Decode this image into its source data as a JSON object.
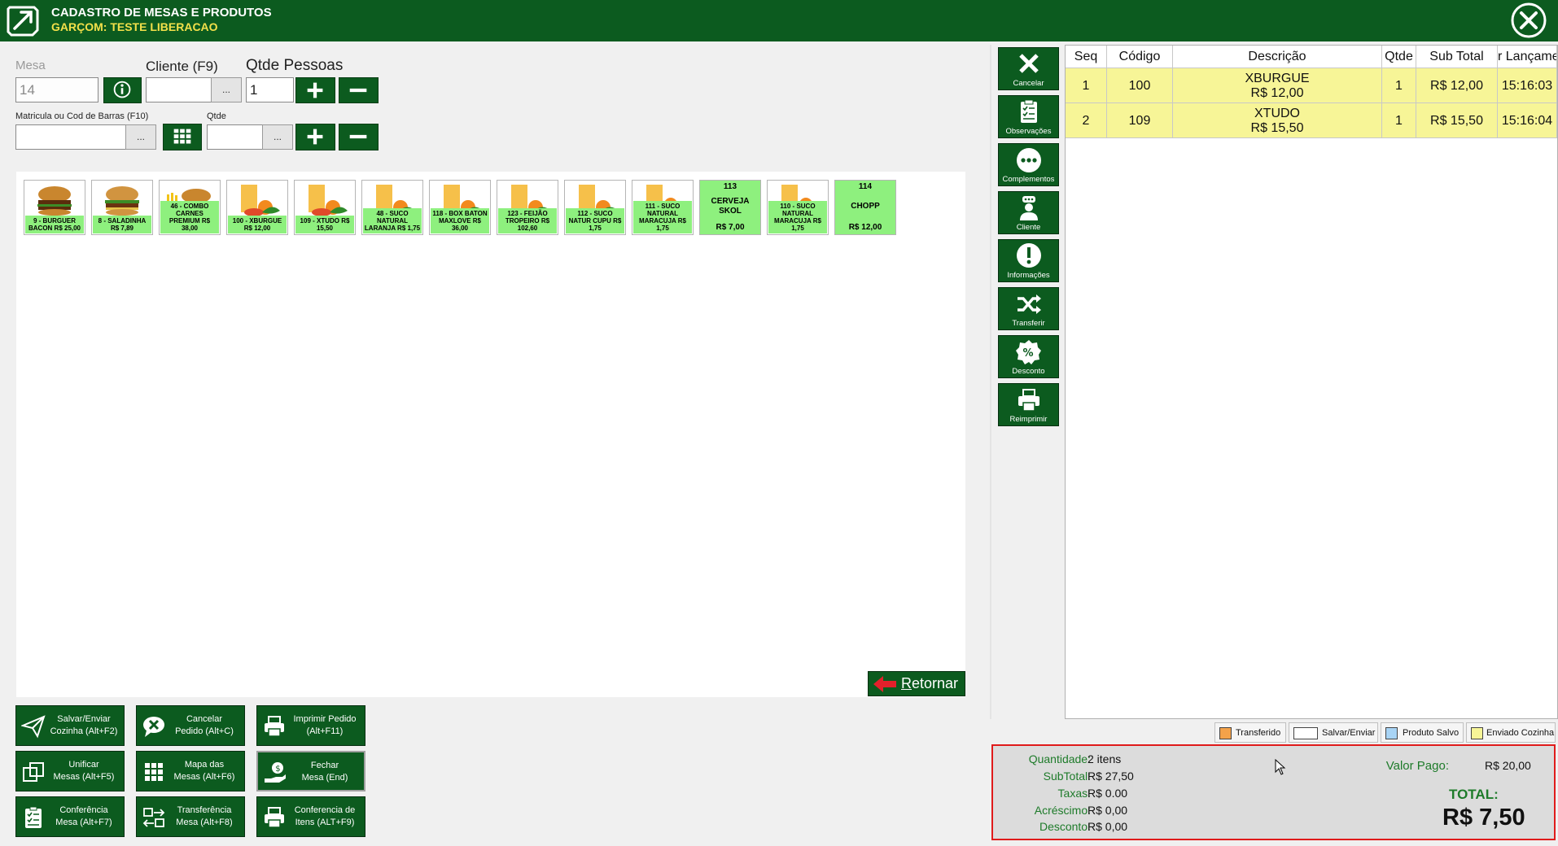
{
  "header": {
    "title": "CADASTRO DE MESAS E PRODUTOS",
    "subtitle": "GARÇOM: TESTE LIBERACAO"
  },
  "form": {
    "mesa_label": "Mesa",
    "mesa_value": "14",
    "cliente_label": "Cliente (F9)",
    "cliente_value": "",
    "qtde_pessoas_label": "Qtde Pessoas",
    "qtde_pessoas_value": "1",
    "matricula_label": "Matricula ou Cod de Barras (F10)",
    "matricula_value": "",
    "qtde_label": "Qtde",
    "qtde_value": "",
    "ellipsis": "..."
  },
  "products": [
    {
      "caption": "9 - BURGUER BACON R$ 25,00",
      "icon": "burger-image"
    },
    {
      "caption": "8 - SALADINHA R$ 7,89",
      "icon": "burger-image"
    },
    {
      "caption": "46 - COMBO CARNES PREMIUM R$ 38,00",
      "icon": "combo-image"
    },
    {
      "caption": "100 - XBURGUE R$ 12,00",
      "icon": "juice-image"
    },
    {
      "caption": "109 - XTUDO R$ 15,50",
      "icon": "juice-image"
    },
    {
      "caption": "48 - SUCO NATURAL LARANJA R$ 1,75",
      "icon": "juice-image"
    },
    {
      "caption": "118 - BOX BATON MAXLOVE R$ 36,00",
      "icon": "juice-image"
    },
    {
      "caption": "123 - FEIJÃO TROPEIRO R$ 102,60",
      "icon": "juice-image"
    },
    {
      "caption": "112 - SUCO NATUR CUPU R$ 1,75",
      "icon": "juice-image"
    },
    {
      "caption": "111 - SUCO NATURAL MARACUJA R$ 1,75",
      "icon": "juice-image"
    },
    {
      "code": "113",
      "name": "CERVEJA SKOL",
      "price": "R$ 7,00"
    },
    {
      "caption": "110 - SUCO NATURAL MARACUJA R$ 1,75",
      "icon": "juice-image"
    },
    {
      "code": "114",
      "name": "CHOPP",
      "price": "R$ 12,00"
    }
  ],
  "retornar": {
    "underline": "R",
    "rest": "etornar"
  },
  "actions": {
    "salvar": [
      "Salvar/Enviar",
      "Cozinha (Alt+F2)"
    ],
    "cancelar": [
      "Cancelar",
      "Pedido (Alt+C)"
    ],
    "imprimir": [
      "Imprimir Pedido",
      "(Alt+F11)"
    ],
    "unificar": [
      "Unificar",
      "Mesas (Alt+F5)"
    ],
    "mapa": [
      "Mapa das",
      "Mesas (Alt+F6)"
    ],
    "fechar": [
      "Fechar",
      "Mesa (End)"
    ],
    "conferencia_mesa": [
      "Conferência",
      "Mesa (Alt+F7)"
    ],
    "transferencia": [
      "Transferência",
      "Mesa (Alt+F8)"
    ],
    "conferencia_itens": [
      "Conferencia de",
      "Itens (ALT+F9)"
    ]
  },
  "side": {
    "cancelar": "Cancelar",
    "observacoes": "Observações",
    "complementos": "Complementos",
    "cliente": "Cliente",
    "informacoes": "Informações",
    "transferir": "Transferir",
    "desconto": "Desconto",
    "reimprimir": "Reimprimir"
  },
  "grid": {
    "headers": [
      "Seq",
      "Código",
      "Descrição",
      "Qtde",
      "Sub Total",
      "r Lançamen"
    ],
    "rows": [
      {
        "seq": "1",
        "codigo": "100",
        "desc": "XBURGUE",
        "desc_price": "R$ 12,00",
        "qtde": "1",
        "subtotal": "R$ 12,00",
        "hora": "15:16:03"
      },
      {
        "seq": "2",
        "codigo": "109",
        "desc": "XTUDO",
        "desc_price": "R$ 15,50",
        "qtde": "1",
        "subtotal": "R$ 15,50",
        "hora": "15:16:04"
      }
    ]
  },
  "legend": {
    "transferido": "Transferido",
    "salvar_enviar": "Salvar/Enviar",
    "produto_salvo": "Produto Salvo",
    "enviado_cozinha": "Enviado Cozinha",
    "colors": {
      "transferido": "#f4a24a",
      "salvar_enviar": "#ffffff",
      "produto_salvo": "#a8d4f5",
      "enviado_cozinha": "#f7f597"
    }
  },
  "summary": {
    "quantidade_label": "Quantidade:",
    "quantidade": "2 itens",
    "subtotal_label": "SubTotal:",
    "subtotal": "R$ 27,50",
    "taxas_label": "Taxas:",
    "taxas": "R$ 0.00",
    "acrescimo_label": "Acréscimo:",
    "acrescimo": "R$ 0,00",
    "desconto_label": "Desconto:",
    "desconto": "R$ 0,00",
    "valor_pago_label": "Valor Pago:",
    "valor_pago": "R$ 20,00",
    "total_label": "TOTAL:",
    "total": "R$ 7,50"
  },
  "colors": {
    "brand_green": "#0c5b1f",
    "product_green": "#8ef07e",
    "row_yellow": "#f7f597",
    "label_green": "#1e7b2a",
    "title_yellow": "#f3e04a"
  }
}
